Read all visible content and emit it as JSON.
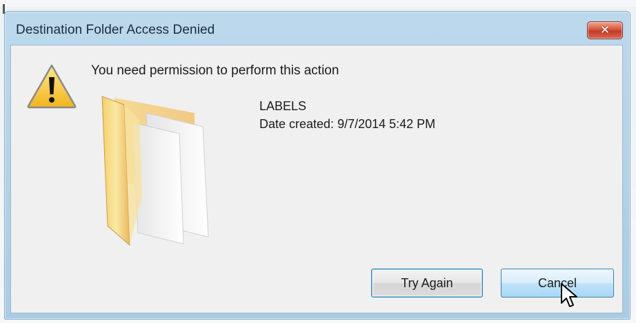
{
  "dialog": {
    "title": "Destination Folder Access Denied",
    "close_icon": "close-icon",
    "close_glyph": "✕",
    "message": "You need permission to perform this action",
    "warning_icon": "warning-icon",
    "folder_icon": "folder-icon",
    "item": {
      "name": "LABELS",
      "date_created": "Date created: 9/7/2014 5:42 PM"
    },
    "buttons": {
      "try_again": "Try Again",
      "cancel": "Cancel"
    },
    "cursor_icon": "mouse-cursor-icon"
  },
  "colors": {
    "titlebar": "#a9cce5",
    "close_button": "#c23b26",
    "client_bg": "#f0f0f0",
    "button_focus_border": "#3c7fb1"
  }
}
